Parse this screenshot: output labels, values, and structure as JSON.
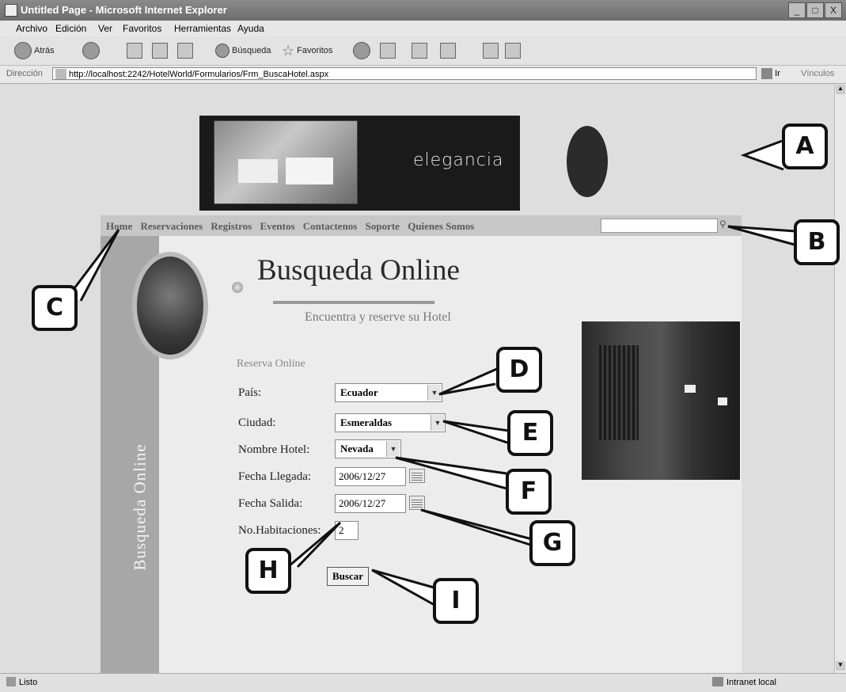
{
  "window": {
    "title": "Untitled Page - Microsoft Internet Explorer",
    "controls": {
      "minimize": "_",
      "maximize": "□",
      "close": "X"
    }
  },
  "menu": [
    "Archivo",
    "Edición",
    "Ver",
    "Favoritos",
    "Herramientas",
    "Ayuda"
  ],
  "toolbar": {
    "back": "Atrás",
    "search": "Búsqueda",
    "favorites": "Favoritos"
  },
  "address": {
    "label": "Dirección",
    "url": "http://localhost:2242/HotelWorld/Formularios/Frm_BuscaHotel.aspx",
    "go": "Ir",
    "links": "Vínculos"
  },
  "status": {
    "left": "Listo",
    "right": "Intranet local"
  },
  "banner": {
    "brand": "elegancia"
  },
  "nav": {
    "links": [
      "Home",
      "Reservaciones",
      "Registros",
      "Eventos",
      "Contactenos",
      "Soporte",
      "Quienes Somos"
    ],
    "search_value": ""
  },
  "page": {
    "sidebar_text": "Busqueda Online",
    "heading": "Busqueda Online",
    "subtitle": "Encuentra y reserve su Hotel",
    "section_label": "Reserva Online"
  },
  "form": {
    "pais": {
      "label": "País:",
      "value": "Ecuador"
    },
    "ciudad": {
      "label": "Ciudad:",
      "value": "Esmeraldas"
    },
    "hotel": {
      "label": "Nombre Hotel:",
      "value": "Nevada"
    },
    "llegada": {
      "label": "Fecha Llegada:",
      "value": "2006/12/27"
    },
    "salida": {
      "label": "Fecha Salida:",
      "value": "2006/12/27"
    },
    "habitaciones": {
      "label": "No.Habitaciones:",
      "value": "2"
    },
    "submit": "Buscar"
  },
  "callouts": [
    "A",
    "B",
    "C",
    "D",
    "E",
    "F",
    "G",
    "H",
    "I"
  ]
}
